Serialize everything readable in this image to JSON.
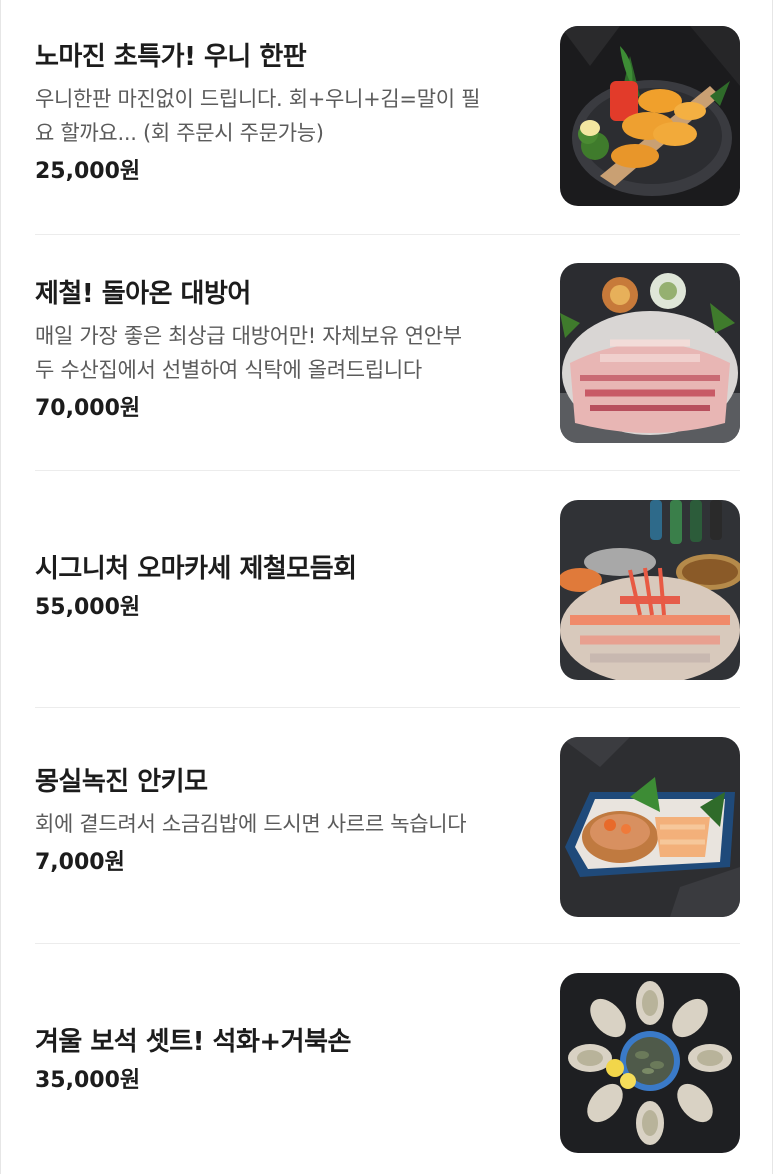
{
  "menu": {
    "items": [
      {
        "name": "노마진 초특가! 우니 한판",
        "desc_line1": "우니한판 마진없이 드립니다. 회+우니+김=말이 필",
        "desc_line2": "요 할까요... (회 주문시 주문가능)",
        "price": "25,000원",
        "image": "sea-urchin-platter-photo"
      },
      {
        "name": "제철! 돌아온 대방어",
        "desc_line1": "매일 가장 좋은 최상급 대방어만! 자체보유 연안부",
        "desc_line2": "두 수산집에서 선별하여 식탁에 올려드립니다",
        "price": "70,000원",
        "image": "yellowtail-sashimi-photo"
      },
      {
        "name": "시그니처 오마카세 제철모듬회",
        "price": "55,000원",
        "image": "omakase-sashimi-photo"
      },
      {
        "name": "몽실녹진 안키모",
        "desc_line1": "회에 곁드려서 소금김밥에 드시면 사르르 녹습니다",
        "price": "7,000원",
        "image": "ankimo-plate-photo"
      },
      {
        "name": "겨울 보석 셋트! 석화+거북손",
        "price": "35,000원",
        "image": "oyster-platter-photo"
      }
    ]
  }
}
